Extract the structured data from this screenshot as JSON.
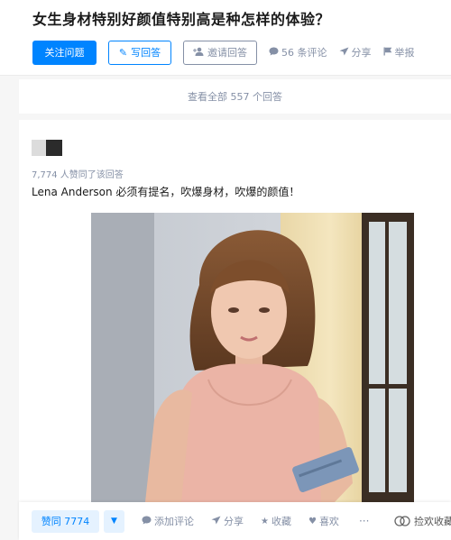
{
  "question": {
    "title": "女生身材特别好颜值特别高是种怎样的体验？",
    "follow_label": "关注问题",
    "write_label": "写回答",
    "invite_label": "邀请回答",
    "comments_label": "56 条评论",
    "share_label": "分享",
    "report_label": "举报"
  },
  "view_all_label": "查看全部 557 个回答",
  "answer": {
    "votes_text": "7,774 人赞同了该回答",
    "content": "Lena Anderson 必须有提名，吹爆身材，吹爆的颜值！",
    "vote_up_label": "赞同 7774",
    "comment_label": "添加评论",
    "share_label": "分享",
    "collect_label": "收藏",
    "like_label": "喜欢",
    "more_label": "···"
  },
  "watermark_text": "捡欢收藏",
  "colors": {
    "accent": "#0084ff",
    "muted": "#8590a6",
    "vote_bg": "#e5f2ff"
  }
}
